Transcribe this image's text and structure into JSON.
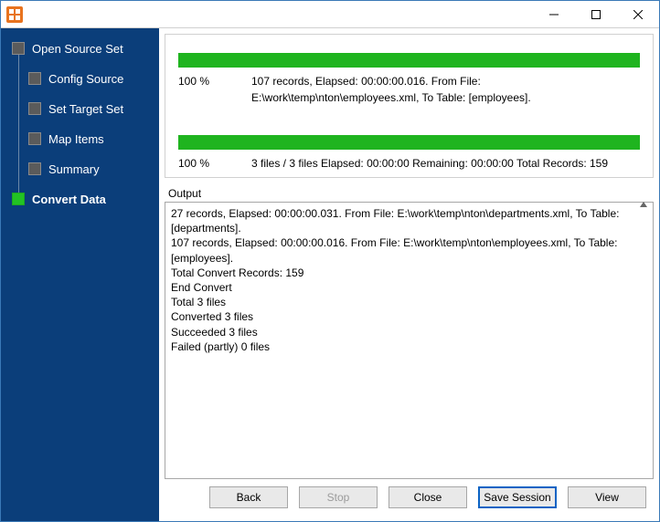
{
  "sidebar": {
    "items": [
      {
        "label": "Open Source Set",
        "active": false,
        "child": false
      },
      {
        "label": "Config Source",
        "active": false,
        "child": true
      },
      {
        "label": "Set Target Set",
        "active": false,
        "child": true
      },
      {
        "label": "Map Items",
        "active": false,
        "child": true
      },
      {
        "label": "Summary",
        "active": false,
        "child": true
      },
      {
        "label": "Convert Data",
        "active": true,
        "child": false
      }
    ]
  },
  "progress": {
    "file": {
      "percent": "100 %",
      "details": "107 records,    Elapsed: 00:00:00.016.    From File: E:\\work\\temp\\nton\\employees.xml,    To Table: [employees]."
    },
    "overall": {
      "percent": "100 %",
      "details": "3 files / 3 files    Elapsed: 00:00:00    Remaining: 00:00:00    Total Records: 159"
    }
  },
  "output": {
    "label": "Output",
    "lines": [
      "27 records,    Elapsed: 00:00:00.031.    From File: E:\\work\\temp\\nton\\departments.xml,    To Table: [departments].",
      "107 records,    Elapsed: 00:00:00.016.    From File: E:\\work\\temp\\nton\\employees.xml,    To Table: [employees].",
      "Total Convert Records: 159",
      "End Convert",
      "Total 3 files",
      "Converted 3 files",
      "Succeeded 3 files",
      "Failed (partly) 0 files"
    ]
  },
  "buttons": {
    "back": "Back",
    "stop": "Stop",
    "close": "Close",
    "save_session": "Save Session",
    "view": "View"
  }
}
